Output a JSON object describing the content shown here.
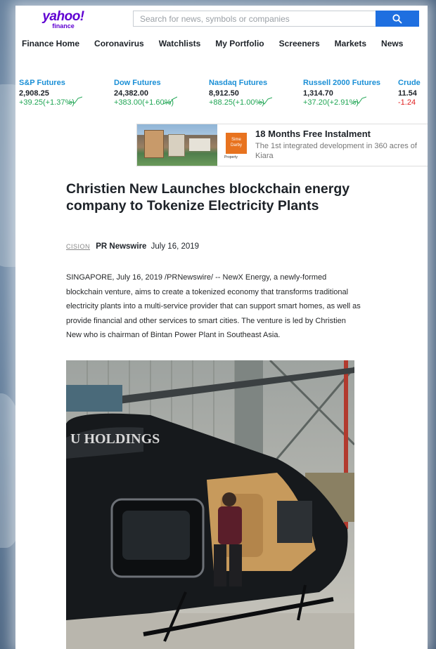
{
  "logo": {
    "line1": "yahoo!",
    "line2": "finance"
  },
  "search": {
    "placeholder": "Search for news, symbols or companies"
  },
  "nav": [
    "Finance Home",
    "Coronavirus",
    "Watchlists",
    "My Portfolio",
    "Screeners",
    "Markets",
    "News"
  ],
  "tickers": [
    {
      "name": "S&P Futures",
      "value": "2,908.25",
      "change": "+39.25(+1.37%)",
      "direction": "up"
    },
    {
      "name": "Dow Futures",
      "value": "24,382.00",
      "change": "+383.00(+1.60%)",
      "direction": "up"
    },
    {
      "name": "Nasdaq Futures",
      "value": "8,912.50",
      "change": "+88.25(+1.00%)",
      "direction": "up"
    },
    {
      "name": "Russell 2000 Futures",
      "value": "1,314.70",
      "change": "+37.20(+2.91%)",
      "direction": "up"
    },
    {
      "name": "Crude",
      "value": "11.54",
      "change": "-1.24",
      "direction": "down"
    }
  ],
  "ad": {
    "logo_text": "Sime Darby",
    "logo_sub": "Property",
    "title": "18 Months Free Instalment",
    "description": "The 1st integrated development in 360 acres of Kiara"
  },
  "article": {
    "headline": "Christien New Launches blockchain energy company to Tokenize Electricity Plants",
    "source_logo": "CISION",
    "source": "PR Newswire",
    "date": "July 16, 2019",
    "body": "SINGAPORE, July 16, 2019 /PRNewswire/ -- NewX Energy, a newly-formed blockchain venture, aims to create a tokenized economy that transforms traditional electricity plants into a multi-service provider that can support smart homes, as well as provide financial and other services to smart cities. The venture is led by Christien New who is chairman of Bintan Power Plant in Southeast Asia.",
    "photo_text": "U HOLDINGS"
  },
  "colors": {
    "accent": "#6001d2",
    "link": "#1a8fd6",
    "up": "#21a655",
    "down": "#e02020",
    "search_button": "#1e6fe0"
  }
}
